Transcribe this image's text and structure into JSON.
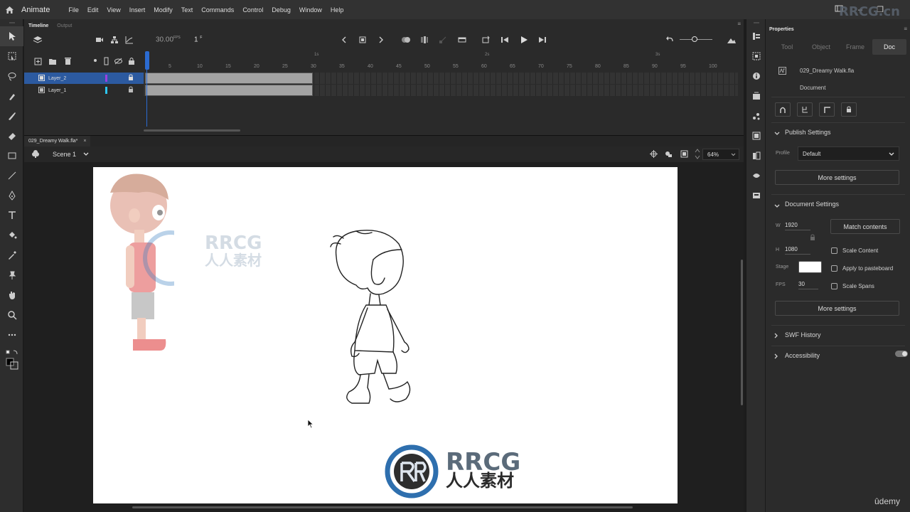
{
  "app": {
    "name": "Animate",
    "menu": [
      "File",
      "Edit",
      "View",
      "Insert",
      "Modify",
      "Text",
      "Commands",
      "Control",
      "Debug",
      "Window",
      "Help"
    ],
    "watermark_top": "RRCG.cn"
  },
  "timeline": {
    "tabs": [
      "Timeline",
      "Output"
    ],
    "fps": "30.00",
    "fps_unit": "FPS",
    "frame": "1",
    "frame_unit": "F",
    "layers": [
      "Layer_2",
      "Layer_1"
    ],
    "layer_colors": [
      "#9b3fe0",
      "#2ec6f0"
    ],
    "ruler_frames": [
      "5",
      "10",
      "15",
      "20",
      "25",
      "30",
      "35",
      "40",
      "45",
      "50",
      "55",
      "60",
      "65",
      "70",
      "75",
      "80",
      "85",
      "90",
      "95",
      "100"
    ],
    "ruler_seconds": [
      "1s",
      "2s",
      "3s"
    ],
    "span_frames": 30
  },
  "document": {
    "tab": "029_Dreamy Walk.fla*",
    "scene": "Scene 1",
    "zoom": "64%"
  },
  "stage": {
    "watermark_cn": "人人素材",
    "watermark_en": "RRCG"
  },
  "properties": {
    "title": "Properties",
    "tabs": [
      "Tool",
      "Object",
      "Frame",
      "Doc"
    ],
    "active_tab": "Doc",
    "file_name": "029_Dreamy Walk.fla",
    "file_type": "Document",
    "publish_settings": "Publish Settings",
    "profile_label": "Profile",
    "profile_value": "Default",
    "more_settings": "More settings",
    "document_settings": "Document Settings",
    "w_label": "W",
    "w_value": "1920",
    "h_label": "H",
    "h_value": "1080",
    "match_contents": "Match contents",
    "scale_content": "Scale Content",
    "stage_label": "Stage",
    "stage_color": "#ffffff",
    "apply_pasteboard": "Apply to pasteboard",
    "fps_label": "FPS",
    "fps_value": "30",
    "scale_spans": "Scale Spans",
    "more_settings_2": "More settings",
    "swf_history": "SWF History",
    "accessibility": "Accessibility"
  },
  "footer": {
    "brand": "ûdemy"
  }
}
